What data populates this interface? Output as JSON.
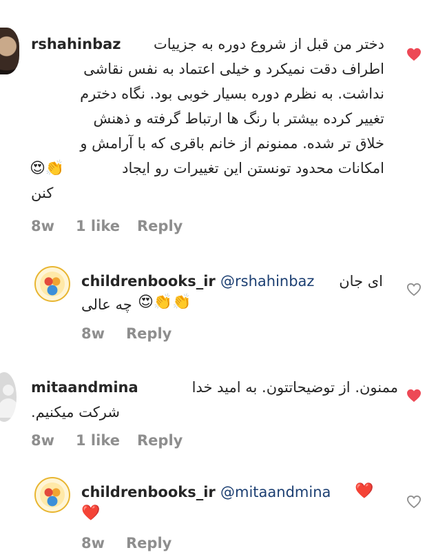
{
  "comments": [
    {
      "username": "rshahinbaz",
      "lines": [
        "دختر من قبل از شروع دوره به جزییات",
        "اطراف دقت نمیکرد و خیلی اعتماد به نفس نقاشی",
        "نداشت. به نظرم دوره بسیار خوبی بود. نگاه دخترم",
        "تغییر کرده بیشتر با رنگ ها ارتباط گرفته و ذهنش",
        "خلاق تر شده. ممنونم از خانم باقری که با آرامش و",
        "امکانات محدود تونستن این تغییرات رو ایجاد",
        "کنن"
      ],
      "emojis": "😍👏",
      "time": "8w",
      "likes": "1 like",
      "reply": "Reply",
      "liked": true
    },
    {
      "username": "childrenbooks_ir",
      "mention": "@rshahinbaz",
      "line1": "ای جان",
      "line2": "چه عالی",
      "emojis": "😍👏👏",
      "time": "8w",
      "reply": "Reply",
      "liked": false
    },
    {
      "username": "mitaandmina",
      "line1": "ممنون. از توضیحاتتون. به امید خدا",
      "line2": "شرکت میکنیم.",
      "time": "8w",
      "likes": "1 like",
      "reply": "Reply",
      "liked": true
    },
    {
      "username": "childrenbooks_ir",
      "mention": "@mitaandmina",
      "emojis": "❤️",
      "emojis2": "❤️",
      "time": "8w",
      "reply": "Reply",
      "liked": false
    }
  ],
  "colors": {
    "text": "#262626",
    "meta": "#8e8e8e",
    "mention": "#1c3f72",
    "heart_liked": "#ed4956",
    "heart_outline": "#8e8e8e"
  },
  "icons": {
    "liked": "filled-heart-icon",
    "unliked": "outline-heart-icon"
  }
}
